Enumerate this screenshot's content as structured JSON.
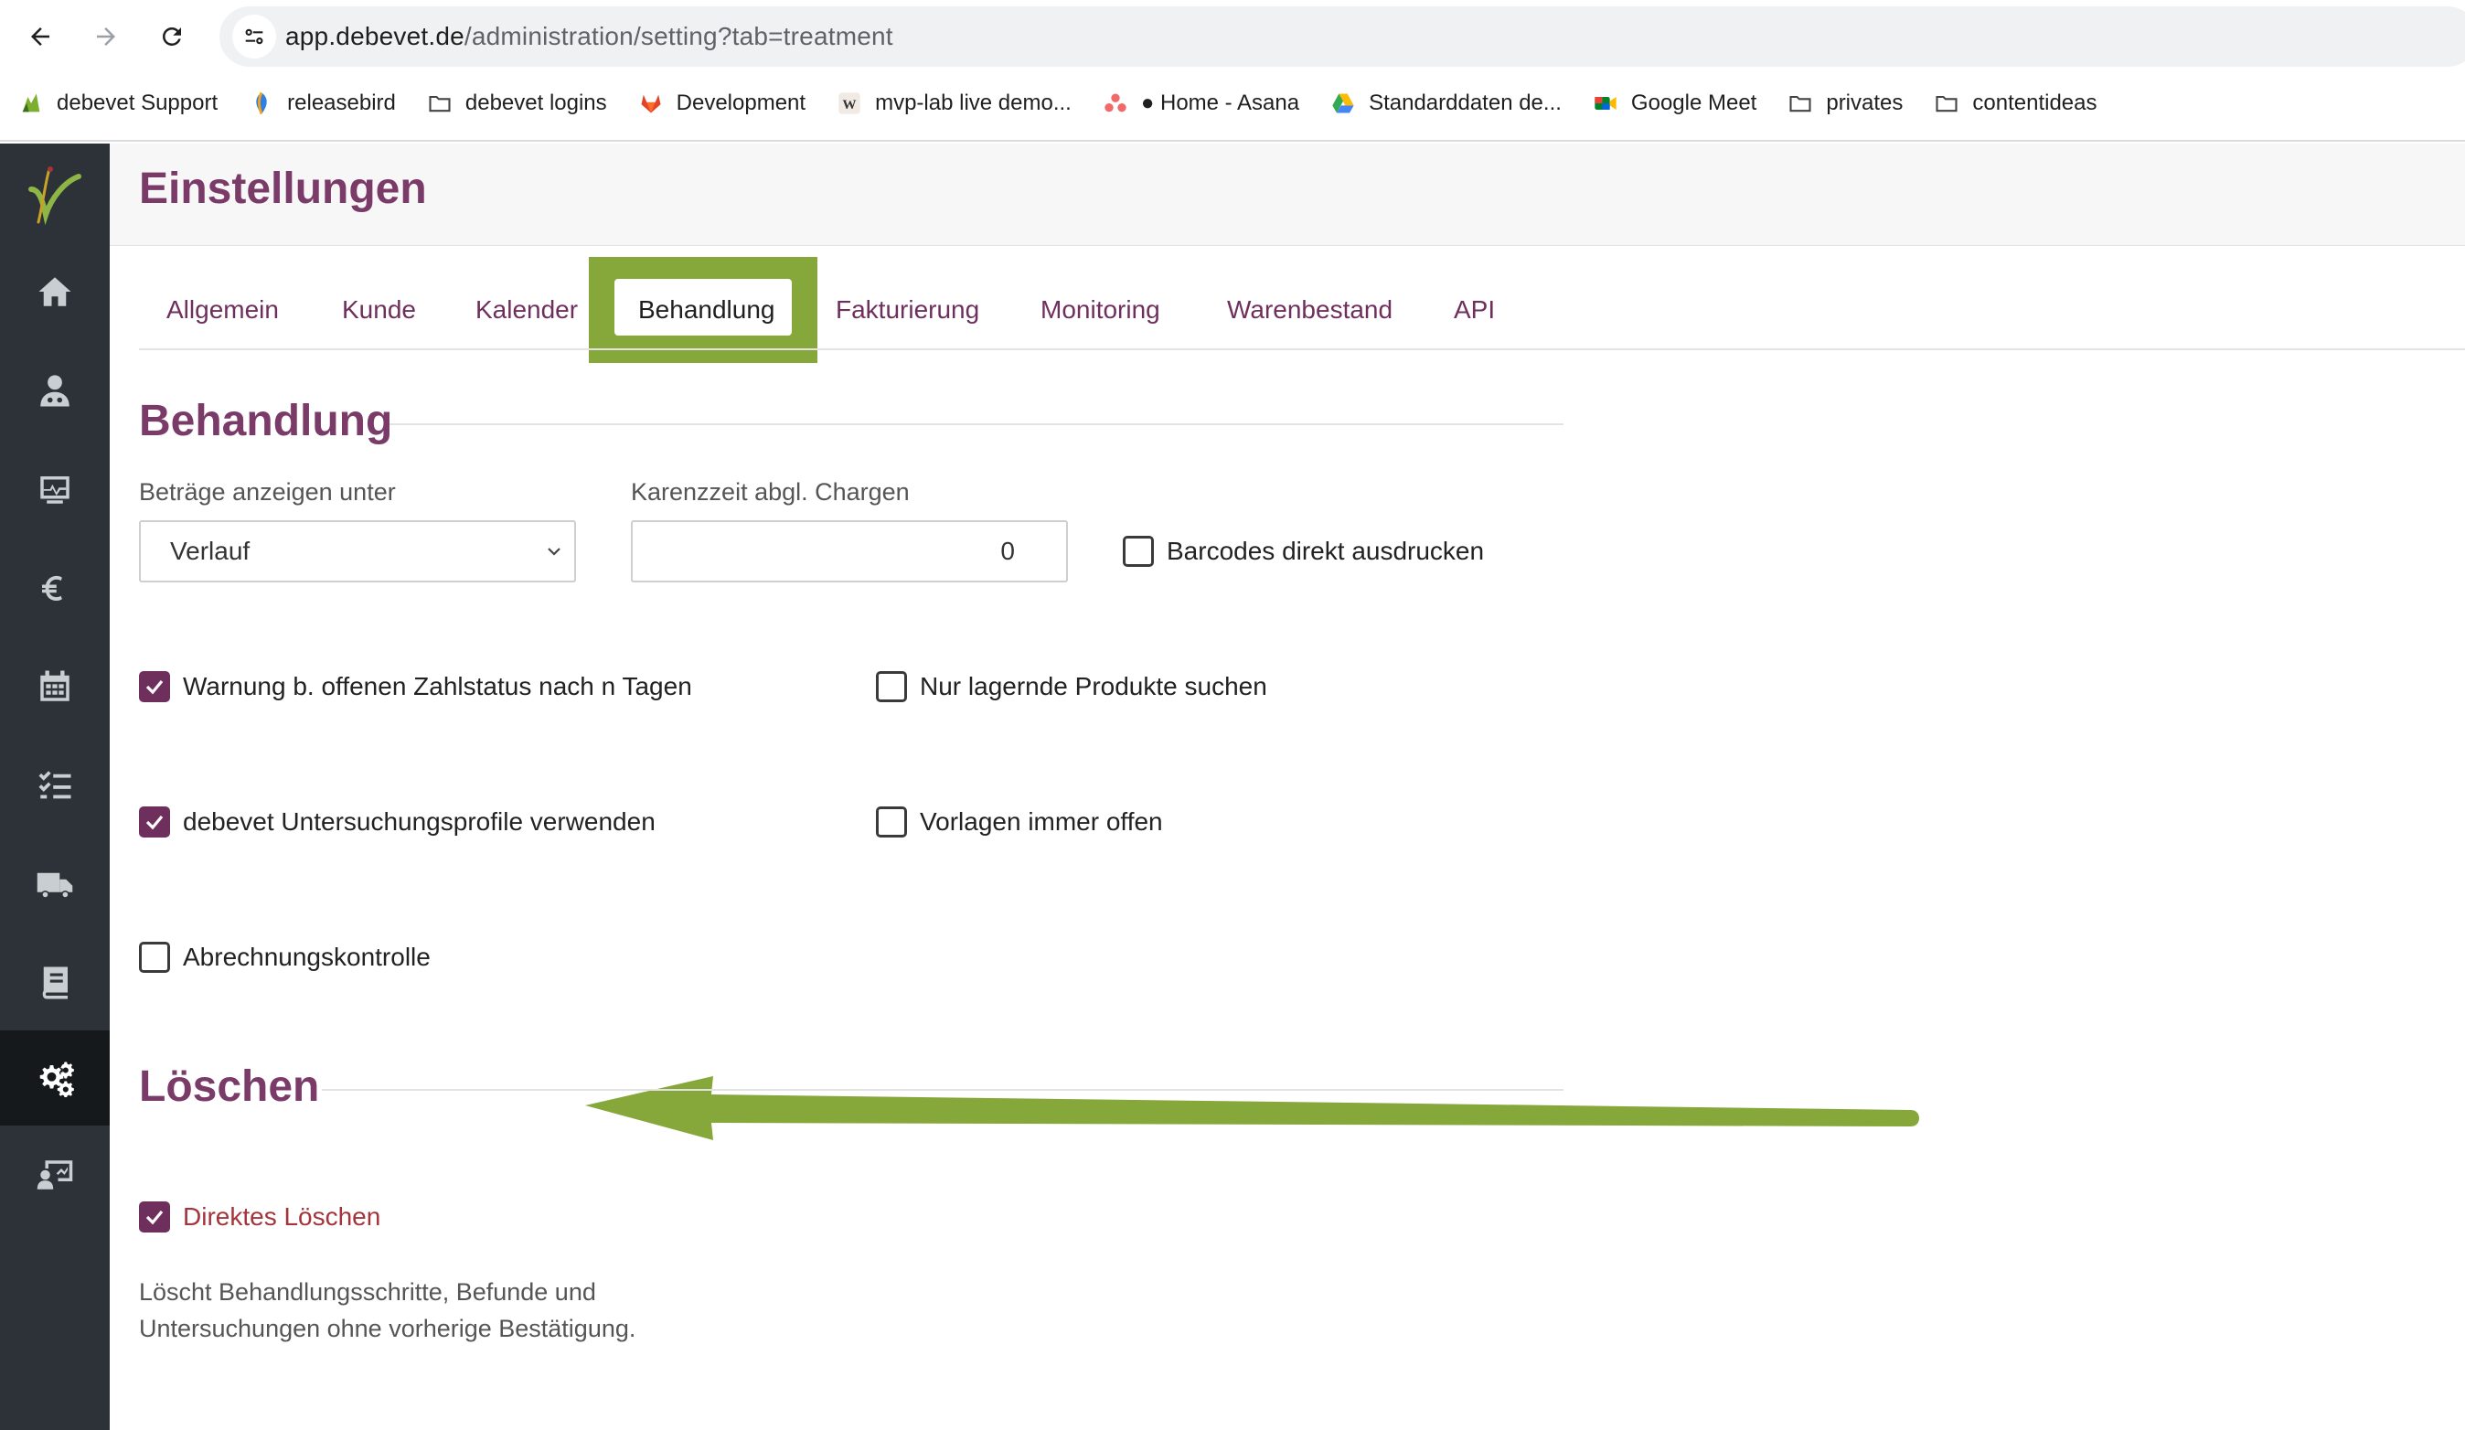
{
  "browser": {
    "url_host": "app.debevet.de",
    "url_path": "/administration/setting?tab=treatment",
    "bookmarks": [
      {
        "label": "debevet Support",
        "icon": "debevet-icon"
      },
      {
        "label": "releasebird",
        "icon": "releasebird-icon"
      },
      {
        "label": "debevet logins",
        "icon": "folder-icon"
      },
      {
        "label": "Development",
        "icon": "gitlab-icon"
      },
      {
        "label": "mvp-lab live demo...",
        "icon": "wp-icon"
      },
      {
        "label": "● Home - Asana",
        "icon": "asana-icon"
      },
      {
        "label": "Standarddaten de...",
        "icon": "drive-icon"
      },
      {
        "label": "Google Meet",
        "icon": "meet-icon"
      },
      {
        "label": "privates",
        "icon": "folder-icon"
      },
      {
        "label": "contentideas",
        "icon": "folder-icon"
      }
    ]
  },
  "sidebar": {
    "items": [
      {
        "name": "home-icon"
      },
      {
        "name": "doctor-icon"
      },
      {
        "name": "monitor-icon"
      },
      {
        "name": "euro-icon"
      },
      {
        "name": "calendar-icon"
      },
      {
        "name": "tasks-icon"
      },
      {
        "name": "truck-icon"
      },
      {
        "name": "book-icon"
      },
      {
        "name": "gears-icon",
        "active": true
      },
      {
        "name": "admin-icon"
      }
    ]
  },
  "page": {
    "title": "Einstellungen",
    "tabs": [
      "Allgemein",
      "Kunde",
      "Kalender",
      "Behandlung",
      "Fakturierung",
      "Monitoring",
      "Warenbestand",
      "API"
    ],
    "active_tab": "Behandlung"
  },
  "behandlung": {
    "heading": "Behandlung",
    "amounts_label": "Beträge anzeigen unter",
    "amounts_value": "Verlauf",
    "karenz_label": "Karenzzeit abgl. Chargen",
    "karenz_value": "0",
    "barcodes_label": "Barcodes direkt ausdrucken",
    "barcodes_checked": false,
    "warnung_label": "Warnung b. offenen Zahlstatus nach n Tagen",
    "warnung_checked": true,
    "lagernd_label": "Nur lagernde Produkte suchen",
    "lagernd_checked": false,
    "profile_label": "debevet Untersuchungsprofile verwenden",
    "profile_checked": true,
    "vorlagen_label": "Vorlagen immer offen",
    "vorlagen_checked": false,
    "abrechnung_label": "Abrechnungskontrolle",
    "abrechnung_checked": false
  },
  "loeschen": {
    "heading": "Löschen",
    "direct_label": "Direktes Löschen",
    "direct_checked": true,
    "description": "Löscht Behandlungsschritte, Befunde und Untersuchungen ohne vorherige Bestätigung."
  },
  "colors": {
    "accent": "#7a3b69",
    "highlight": "#86a73a",
    "sidebar": "#2c3237"
  }
}
